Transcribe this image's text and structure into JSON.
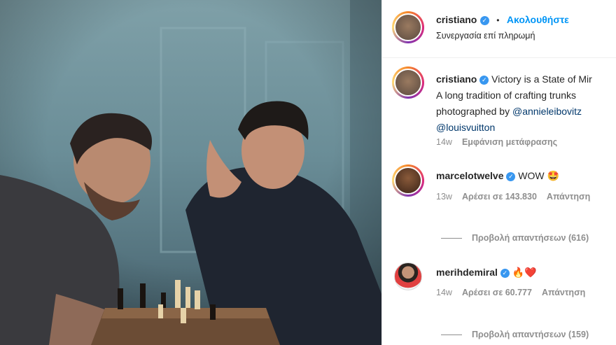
{
  "post_header": {
    "username": "cristiano",
    "dot": "•",
    "follow_label": "Ακολουθήστε",
    "subtitle": "Συνεργασία επί πληρωμή"
  },
  "caption": {
    "username": "cristiano",
    "line1": "Victory is a State of Mir",
    "line2": "A long tradition of crafting trunks",
    "line3_prefix": "photographed by ",
    "line3_mention": "@annieleibovitz",
    "line4_mention": "@louisvuitton",
    "time": "14w",
    "translate_label": "Εμφάνιση μετάφρασης"
  },
  "comments": [
    {
      "username": "marcelotwelve",
      "text": "WOW 🤩",
      "time": "13w",
      "likes": "Αρέσει σε 143.830",
      "reply_label": "Απάντηση",
      "view_replies": "Προβολή απαντήσεων (616)"
    },
    {
      "username": "merihdemiral",
      "text": "🔥❤️",
      "time": "14w",
      "likes": "Αρέσει σε 60.777",
      "reply_label": "Απάντηση",
      "view_replies": "Προβολή απαντήσεων (159)"
    }
  ],
  "colors": {
    "link_blue": "#0095f6",
    "verified_blue": "#3897f0",
    "muted_text": "#8e8e8e"
  }
}
